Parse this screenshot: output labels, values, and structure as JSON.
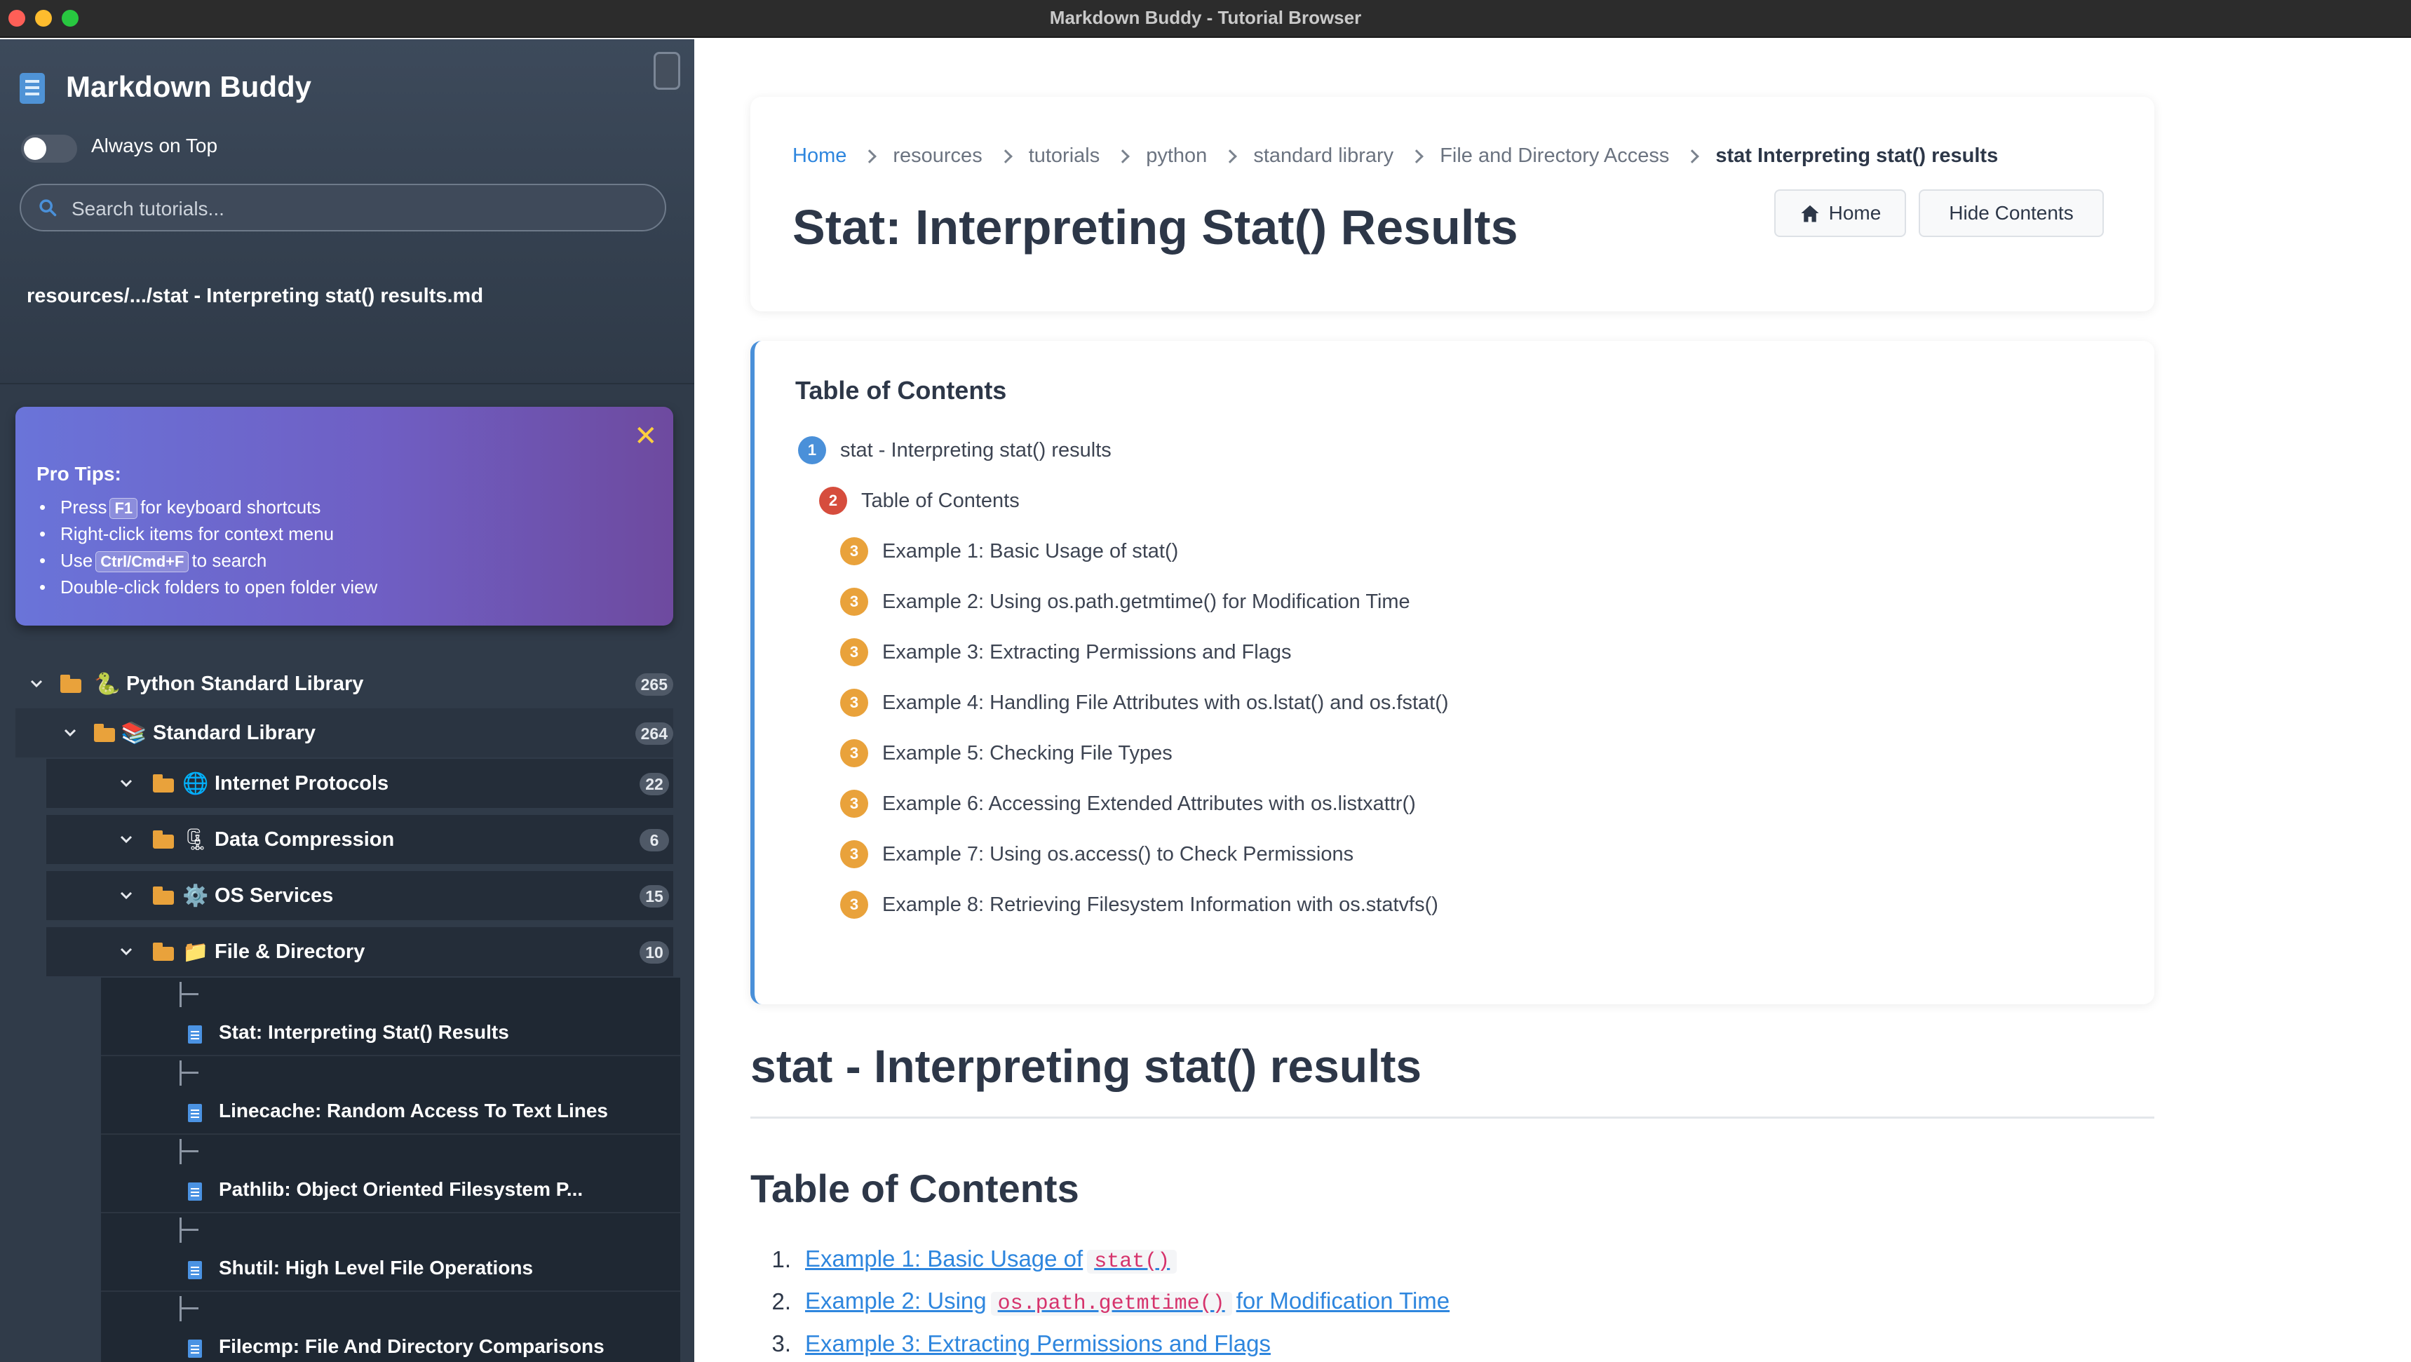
{
  "window": {
    "title": "Markdown Buddy - Tutorial Browser"
  },
  "sidebar": {
    "app_title": "Markdown Buddy",
    "always_on_top_label": "Always on Top",
    "always_on_top_on": false,
    "search_placeholder": "Search tutorials...",
    "current_path": "resources/.../stat - Interpreting stat() results.md",
    "tips": {
      "heading": "Pro Tips:",
      "items": [
        {
          "pre": "Press",
          "key": "F1",
          "post": "for keyboard shortcuts"
        },
        {
          "pre": "Right-click items for context menu",
          "key": "",
          "post": ""
        },
        {
          "pre": "Use",
          "key": "Ctrl/Cmd+F",
          "post": "to search"
        },
        {
          "pre": "Double-click folders to open folder view",
          "key": "",
          "post": ""
        }
      ]
    },
    "tree": [
      {
        "label": "Python Standard Library",
        "emoji": "🐍",
        "count": "265"
      },
      {
        "label": "Standard Library",
        "emoji": "📚",
        "count": "264"
      },
      {
        "label": "Internet Protocols",
        "emoji": "🌐",
        "count": "22"
      },
      {
        "label": "Data Compression",
        "emoji": "🗜",
        "count": "6"
      },
      {
        "label": "OS Services",
        "emoji": "⚙️",
        "count": "15"
      },
      {
        "label": "File & Directory",
        "emoji": "📁",
        "count": "10"
      }
    ],
    "files": [
      "Stat: Interpreting Stat() Results",
      "Linecache: Random Access To Text Lines",
      "Pathlib: Object Oriented Filesystem P...",
      "Shutil: High Level File Operations",
      "Filecmp: File And Directory Comparisons"
    ]
  },
  "main": {
    "breadcrumbs": [
      "Home",
      "resources",
      "tutorials",
      "python",
      "standard library",
      "File and Directory Access",
      "stat Interpreting stat() results"
    ],
    "page_title": "Stat: Interpreting Stat() Results",
    "home_button": "Home",
    "hide_contents_button": "Hide Contents",
    "toc": {
      "title": "Table of Contents",
      "items": [
        {
          "level": "1",
          "text": "stat - Interpreting stat() results"
        },
        {
          "level": "2",
          "text": "Table of Contents"
        },
        {
          "level": "3",
          "text": "Example 1: Basic Usage of stat()"
        },
        {
          "level": "3",
          "text": "Example 2: Using os.path.getmtime() for Modification Time"
        },
        {
          "level": "3",
          "text": "Example 3: Extracting Permissions and Flags"
        },
        {
          "level": "3",
          "text": "Example 4: Handling File Attributes with os.lstat() and os.fstat()"
        },
        {
          "level": "3",
          "text": "Example 5: Checking File Types"
        },
        {
          "level": "3",
          "text": "Example 6: Accessing Extended Attributes with os.listxattr()"
        },
        {
          "level": "3",
          "text": "Example 7: Using os.access() to Check Permissions"
        },
        {
          "level": "3",
          "text": "Example 8: Retrieving Filesystem Information with os.statvfs()"
        }
      ]
    },
    "content": {
      "h1": "stat - Interpreting stat() results",
      "h2": "Table of Contents",
      "list": [
        {
          "n": "1.",
          "pre": "Example 1: Basic Usage of",
          "code": "stat()",
          "post": ""
        },
        {
          "n": "2.",
          "pre": "Example 2: Using",
          "code": "os.path.getmtime()",
          "post": "for Modification Time"
        },
        {
          "n": "3.",
          "pre": "Example 3: Extracting Permissions and Flags",
          "code": "",
          "post": ""
        }
      ]
    }
  }
}
